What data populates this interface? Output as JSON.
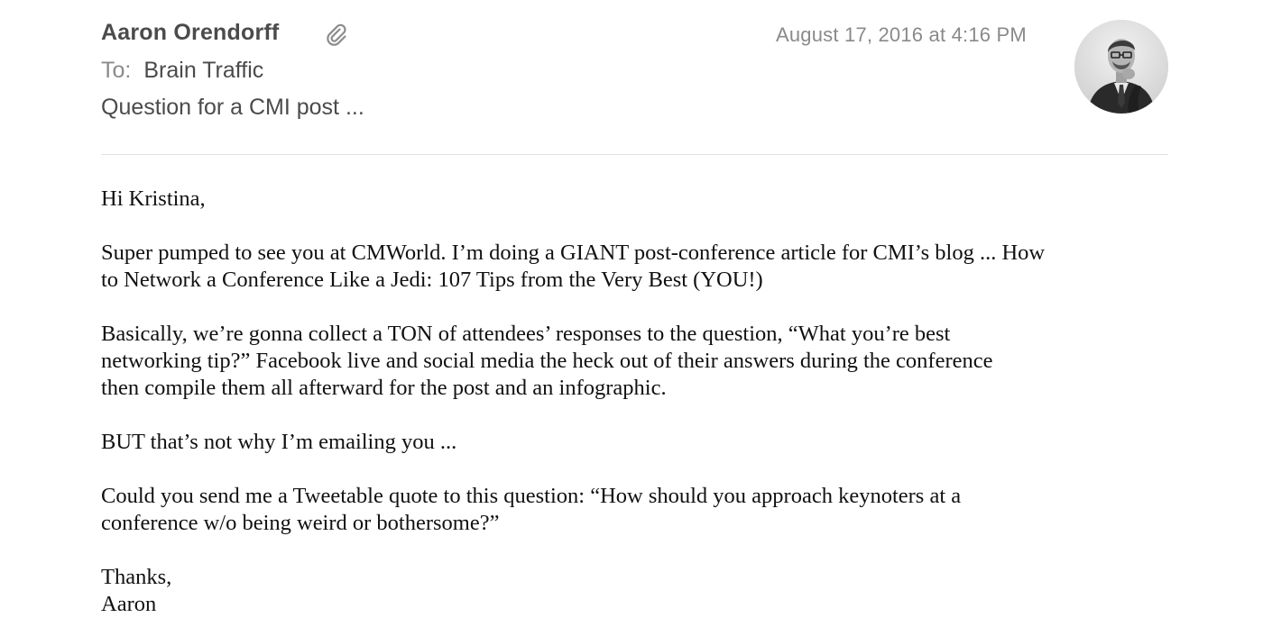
{
  "email": {
    "sender": "Aaron Orendorff",
    "date": "August 17, 2016 at 4:16 PM",
    "to_label": "To:",
    "to": "Brain Traffic",
    "subject": "Question for a CMI post ...",
    "attachment_icon": "paperclip-icon",
    "avatar_icon": "sender-avatar"
  },
  "body": {
    "greeting": "Hi Kristina,",
    "para1_line1": "Super pumped to see you at CMWorld. I’m doing a GIANT post-conference article for CMI’s blog ... How",
    "para1_line2": "to Network a Conference Like a Jedi: 107 Tips from the Very Best (YOU!)",
    "para2_line1": "Basically, we’re gonna collect a TON of attendees’ responses to the question, “What you’re best",
    "para2_line2": "networking tip?” Facebook live and social media the heck out of their answers during the conference",
    "para2_line3": "then compile them all afterward for the post and an infographic.",
    "para3": "BUT that’s not why I’m emailing you ...",
    "para4_line1": "Could you send me a Tweetable quote to this question: “How should you approach keynoters at a",
    "para4_line2": "conference w/o being weird or bothersome?”",
    "signoff": "Thanks,",
    "signature": "Aaron"
  }
}
